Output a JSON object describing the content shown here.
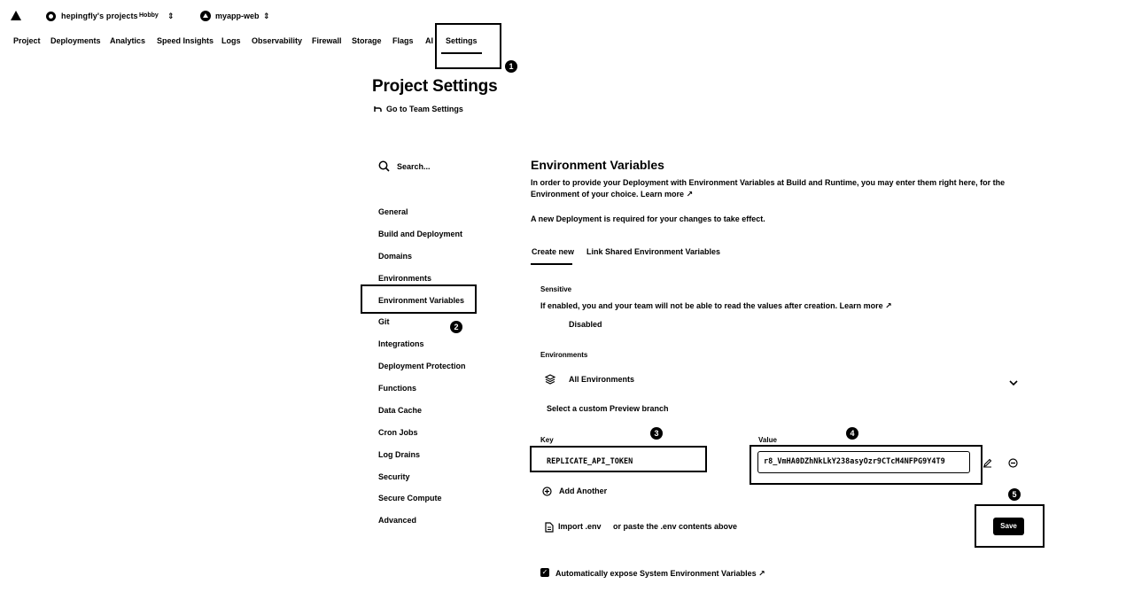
{
  "header": {
    "team_name": "hepingfly's projects",
    "team_plan": "Hobby",
    "project_name": "myapp-web",
    "nav": [
      "Project",
      "Deployments",
      "Analytics",
      "Speed Insights",
      "Logs",
      "Observability",
      "Firewall",
      "Storage",
      "Flags",
      "AI",
      "Settings"
    ],
    "active_nav": "Settings"
  },
  "page": {
    "title": "Project Settings",
    "back_link": "Go to Team Settings"
  },
  "sidebar": {
    "search_placeholder": "Search...",
    "items": [
      "General",
      "Build and Deployment",
      "Domains",
      "Environments",
      "Environment Variables",
      "Git",
      "Integrations",
      "Deployment Protection",
      "Functions",
      "Data Cache",
      "Cron Jobs",
      "Log Drains",
      "Security",
      "Secure Compute",
      "Advanced"
    ],
    "active_item": "Environment Variables"
  },
  "env_vars": {
    "title": "Environment Variables",
    "description_prefix": "In order to provide your Deployment with Environment Variables at Build and Runtime, you may enter them right here, for the Environment of your choice.",
    "learn_more": "Learn more",
    "notice": "A new Deployment is required for your changes to take effect.",
    "tabs": [
      "Create new",
      "Link Shared Environment Variables"
    ],
    "sensitive_label": "Sensitive",
    "sensitive_desc": "If enabled, you and your team will not be able to read the values after creation.",
    "sensitive_learn_more": "Learn more",
    "sensitive_state": "Disabled",
    "environments_label": "Environments",
    "environments_value": "All Environments",
    "preview_branch": "Select a custom Preview branch",
    "key_label": "Key",
    "key_value": "REPLICATE_API_TOKEN",
    "value_label": "Value",
    "value_value": "r8_VmHA0DZhNkLkY238asyOzr9CTcM4NFPG9Y4T9",
    "add_another": "Add Another",
    "import_env": "Import .env",
    "paste_hint": "or paste the .env contents above",
    "save": "Save",
    "auto_expose": "Automatically expose System Environment Variables"
  },
  "annotations": [
    "1",
    "2",
    "3",
    "4",
    "5"
  ]
}
